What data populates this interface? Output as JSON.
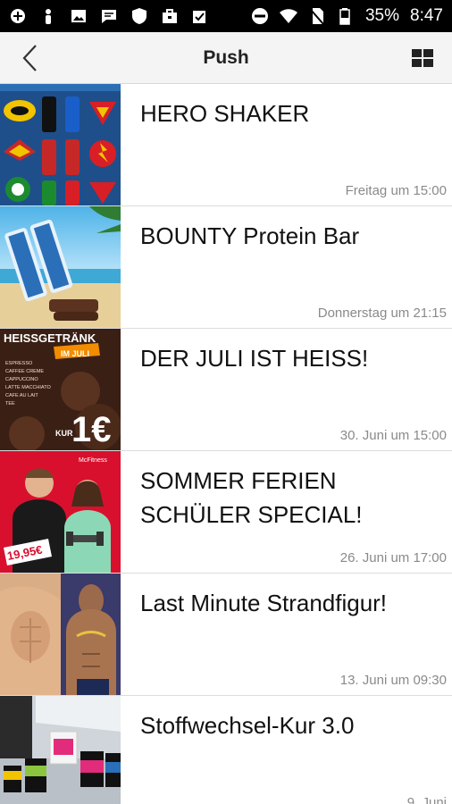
{
  "status_bar": {
    "battery": "35%",
    "time": "8:47",
    "icons": [
      "app-icon",
      "figure-icon",
      "gallery-icon",
      "message-icon",
      "shield-icon",
      "briefcase-icon",
      "clipboard-check-icon",
      "do-not-disturb-icon",
      "wifi-icon",
      "no-sim-icon",
      "battery-icon"
    ]
  },
  "header": {
    "title": "Push",
    "back_icon": "back-arrow-icon",
    "grid_icon": "grid-view-icon"
  },
  "thumbnail_texts": {
    "item3_headline": "HEISSGETRÄNK",
    "item3_badge": "IM JULI",
    "item3_menu": [
      "ESPRESSO",
      "CAFFEE CREME",
      "CAPPUCCINO",
      "LATTE MACCHIATO",
      "CAFE AU LAIT",
      "TEE"
    ],
    "item3_price_prefix": "KUR",
    "item3_price": "1€",
    "item4_logo": "McFitness",
    "item4_price": "19,95€"
  },
  "items": [
    {
      "title": "HERO SHAKER",
      "date": "Freitag um 15:00"
    },
    {
      "title": "BOUNTY Protein Bar",
      "date": "Donnerstag um 21:15"
    },
    {
      "title": "DER JULI IST HEISS!",
      "date": "30. Juni um 15:00"
    },
    {
      "title": "SOMMER FERIEN SCHÜLER SPECIAL!",
      "date": "26. Juni um 17:00"
    },
    {
      "title": "Last Minute Strandfigur!",
      "date": "13. Juni um 09:30"
    },
    {
      "title": "Stoffwechsel-Kur 3.0",
      "date": "9. Juni"
    }
  ],
  "colors": {
    "status_bar_bg": "#000000",
    "app_bar_bg": "#f4f4f4",
    "date_text": "#8a8a8a",
    "title_text": "#111111"
  }
}
